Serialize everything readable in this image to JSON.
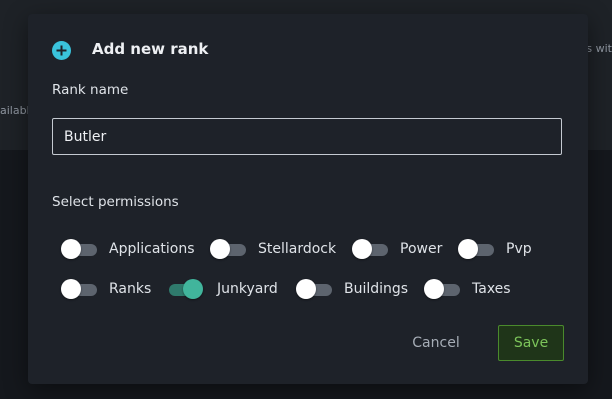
{
  "background": {
    "left_fragment": "ailabl",
    "right_fragment": "s wit"
  },
  "modal": {
    "title": "Add new rank",
    "icon": "plus-circle-icon",
    "rank_name_label": "Rank name",
    "rank_name_value": "Butler",
    "permissions_label": "Select permissions",
    "permissions": [
      {
        "label": "Applications",
        "enabled": false
      },
      {
        "label": "Stellardock",
        "enabled": false
      },
      {
        "label": "Power",
        "enabled": false
      },
      {
        "label": "Pvp",
        "enabled": false
      },
      {
        "label": "Ranks",
        "enabled": false
      },
      {
        "label": "Junkyard",
        "enabled": true
      },
      {
        "label": "Buildings",
        "enabled": false
      },
      {
        "label": "Taxes",
        "enabled": false
      }
    ],
    "cancel_label": "Cancel",
    "save_label": "Save"
  },
  "colors": {
    "accent_icon": "#3ac3dc",
    "toggle_on": "#41b59c",
    "save_text": "#7cc45a",
    "save_border": "#4a8a2c"
  }
}
